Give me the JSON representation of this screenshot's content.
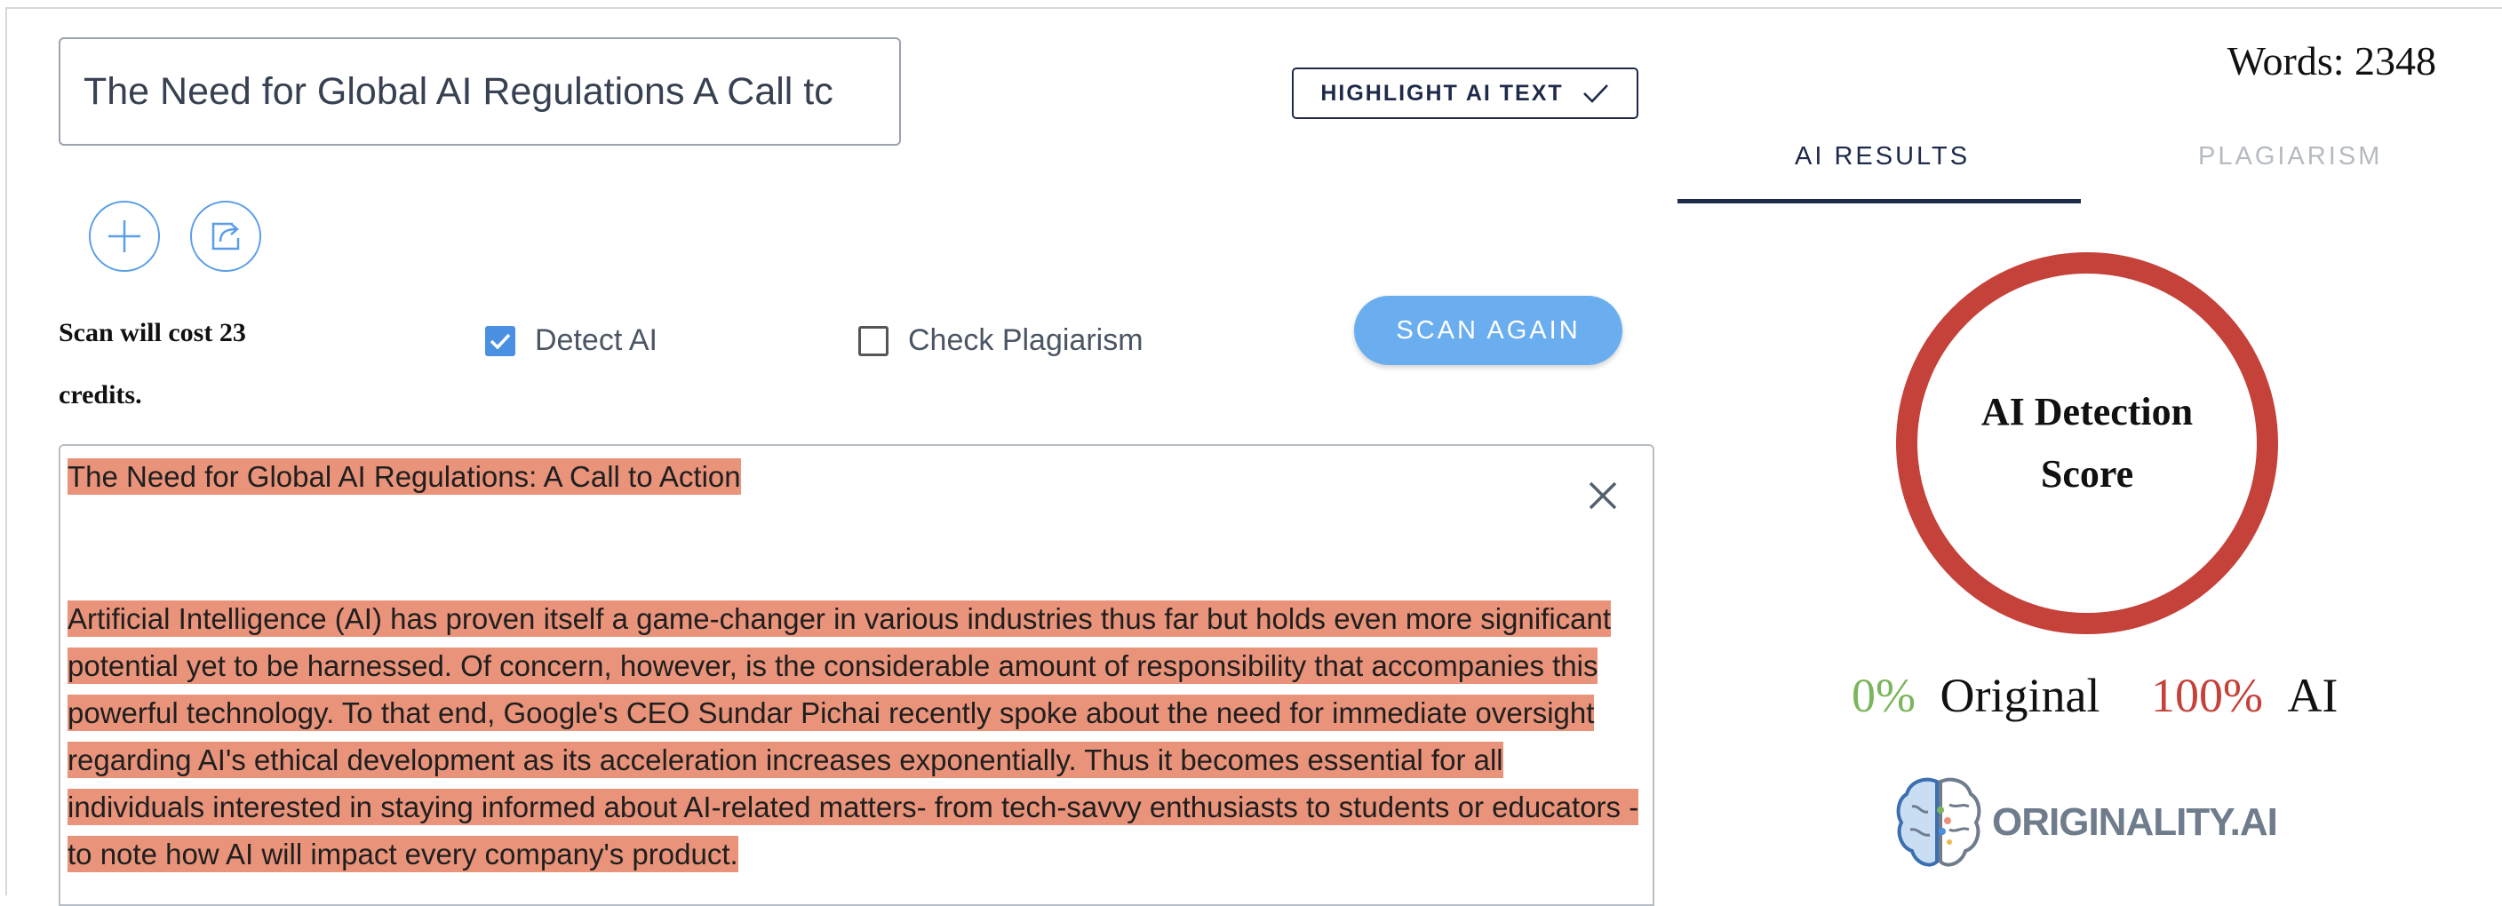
{
  "editor": {
    "title_value": "The Need for Global AI Regulations A Call tc",
    "highlight_button": "HIGHLIGHT AI TEXT",
    "cost_text": "Scan will cost 23 credits.",
    "detect_ai": {
      "label": "Detect AI",
      "checked": true
    },
    "check_plagiarism": {
      "label": "Check Plagiarism",
      "checked": false
    },
    "scan_button": "SCAN AGAIN",
    "document": {
      "title": "The Need for Global AI Regulations: A Call to Action",
      "body": "Artificial Intelligence (AI) has proven itself a game-changer in various industries thus far but holds even more significant potential yet to be harnessed. Of concern, however, is the considerable amount of responsibility that accompanies this powerful technology. To that end, Google's CEO Sundar Pichai recently spoke about the need for immediate oversight regarding AI's ethical development as its acceleration increases exponentially. Thus it becomes essential for all individuals interested in staying informed about AI-related matters- from tech-savvy enthusiasts to students or educators -to note how AI will impact every company's product."
    }
  },
  "results": {
    "words": "Words: 2348",
    "tabs": [
      {
        "label": "AI RESULTS",
        "active": true
      },
      {
        "label": "PLAGIARISM",
        "active": false
      }
    ],
    "score_label": "AI Detection Score",
    "original_pct": "0%",
    "original_label": "Original",
    "ai_pct": "100%",
    "ai_label": "AI",
    "logo_text": "ORIGINALITY.AI"
  },
  "colors": {
    "accent": "#4a90e2",
    "ai_red": "#c5423a",
    "original_green": "#7cb55c",
    "highlight": "#e9937a",
    "navy": "#1e2a4a"
  },
  "icons": [
    "check-icon",
    "plus-icon",
    "share-icon",
    "checkbox-checked-icon",
    "checkbox-empty-icon",
    "close-icon",
    "brain-logo-icon"
  ]
}
